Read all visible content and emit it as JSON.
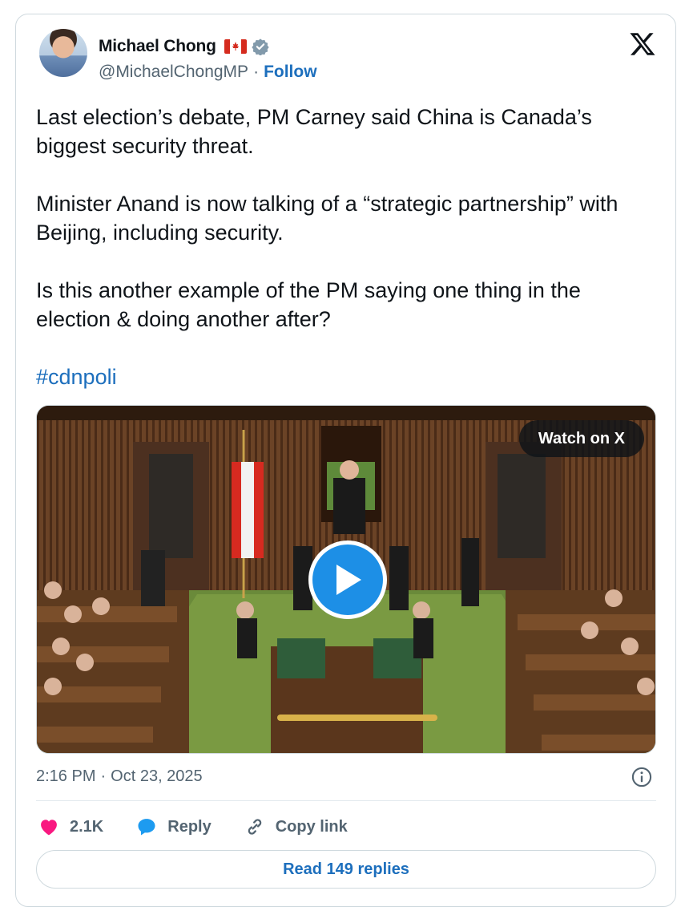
{
  "author": {
    "name": "Michael Chong",
    "handle": "@MichaelChongMP",
    "separator": "·",
    "follow_label": "Follow",
    "flag_icon": "canada-flag-icon",
    "verified_icon": "verified-badge-icon"
  },
  "tweet": {
    "paragraphs": [
      "Last election’s debate, PM Carney said China is Canada’s biggest security threat.",
      "Minister Anand is now talking of a “strategic partnership” with Beijing, including security.",
      "Is this another example of the PM saying one thing in the election & doing another after?"
    ],
    "hashtag": "#cdnpoli"
  },
  "media": {
    "watch_label": "Watch on X",
    "play_icon": "play-icon"
  },
  "meta": {
    "time": "2:16 PM",
    "separator": "·",
    "date": "Oct 23, 2025"
  },
  "actions": {
    "likes": "2.1K",
    "reply_label": "Reply",
    "copy_label": "Copy link"
  },
  "read_replies_label": "Read 149 replies",
  "colors": {
    "link": "#1d6fbd",
    "heart": "#f91880",
    "reply_bubble": "#1d9bf0",
    "muted": "#536471",
    "border": "#cfd9de"
  }
}
